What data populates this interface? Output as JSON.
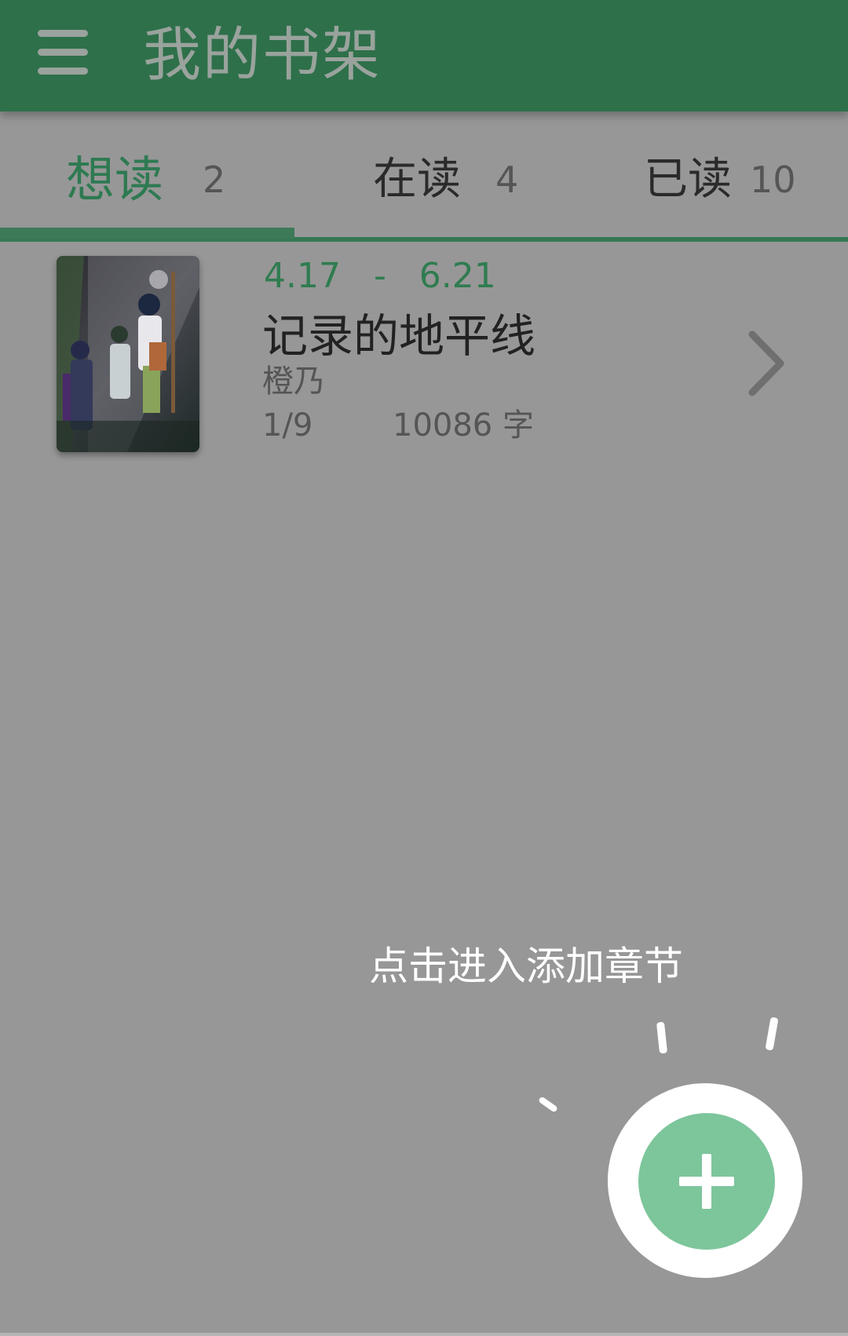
{
  "header": {
    "title": "我的书架",
    "menu_icon": "hamburger-menu-icon"
  },
  "tabs": [
    {
      "label": "想读",
      "count": "2",
      "active": true
    },
    {
      "label": "在读",
      "count": "4",
      "active": false
    },
    {
      "label": "已读",
      "count": "10",
      "active": false
    }
  ],
  "books": [
    {
      "start_date": "4.17",
      "separator": "-",
      "end_date": "6.21",
      "title": "记录的地平线",
      "author": "橙乃",
      "progress": "1/9",
      "words": "10086 字",
      "cover_icon": "book-cover-image",
      "chevron_icon": "chevron-right-icon"
    }
  ],
  "fab": {
    "hint": "点击进入添加章节",
    "icon": "plus-icon"
  },
  "colors": {
    "primary": "#2e704a",
    "accent_text": "#2f7c50",
    "fab": "#7dc59b",
    "overlay": "#979797"
  }
}
